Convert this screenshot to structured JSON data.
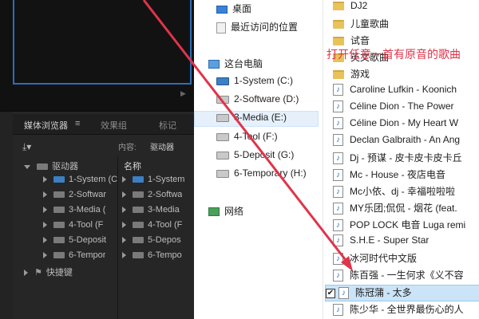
{
  "premiere": {
    "tabs": [
      {
        "label": "媒体浏览器"
      },
      {
        "label": "效果组"
      },
      {
        "label": "标记"
      }
    ],
    "tab_menu": "≡",
    "filter_label": "内容:",
    "filter_value": "驱动器",
    "tree_root": "驱动器",
    "drives": [
      "1-System (C",
      "2-Softwar",
      "3-Media (",
      "4-Tool (F",
      "5-Deposit",
      "6-Tempor"
    ],
    "shortcuts": "快捷键",
    "names_header": "名称",
    "name_items": [
      "1-System",
      "2-Softwa",
      "3-Media",
      "4-Tool (F",
      "5-Depos",
      "6-Tempo"
    ]
  },
  "nav": {
    "items": [
      {
        "label": "桌面",
        "icon": "desktop-icon"
      },
      {
        "label": "最近访问的位置",
        "icon": "recent-icon"
      },
      {
        "label": "这台电脑",
        "icon": "computer-icon"
      },
      {
        "label": "1-System (C:)",
        "icon": "system-drive-icon"
      },
      {
        "label": "2-Software (D:)",
        "icon": "drive-icon"
      },
      {
        "label": "3-Media (E:)",
        "icon": "drive-icon"
      },
      {
        "label": "4-Tool (F:)",
        "icon": "drive-icon"
      },
      {
        "label": "5-Deposit (G:)",
        "icon": "drive-icon"
      },
      {
        "label": "6-Temporary (H:)",
        "icon": "drive-icon"
      },
      {
        "label": "网络",
        "icon": "network-icon"
      }
    ]
  },
  "files": [
    {
      "label": "DJ2",
      "type": "folder"
    },
    {
      "label": "儿童歌曲",
      "type": "folder"
    },
    {
      "label": "试音",
      "type": "folder"
    },
    {
      "label": "英文歌曲",
      "type": "folder"
    },
    {
      "label": "游戏",
      "type": "folder"
    },
    {
      "label": "Caroline Lufkin - Koonich",
      "type": "audio"
    },
    {
      "label": "Céline  Dion - The  Power",
      "type": "audio"
    },
    {
      "label": "Céline Dion - My Heart W",
      "type": "audio"
    },
    {
      "label": "Declan Galbraith - An Ang",
      "type": "audio"
    },
    {
      "label": "Dj - 预谋 - 皮卡皮卡皮卡丘",
      "type": "audio"
    },
    {
      "label": "Mc - House - 夜店电音",
      "type": "audio"
    },
    {
      "label": "Mc小依、dj - 幸福啦啦啦",
      "type": "audio"
    },
    {
      "label": "MY乐团;侃侃 - 烟花 (feat.",
      "type": "audio"
    },
    {
      "label": "POP LOCK 电音 Luga remi",
      "type": "audio"
    },
    {
      "label": "S.H.E - Super Star",
      "type": "audio"
    },
    {
      "label": "冰河时代中文版",
      "type": "audio"
    },
    {
      "label": "陈百强 - 一生何求《义不容",
      "type": "audio"
    },
    {
      "label": "陈冠蒲 - 太多",
      "type": "audio",
      "selected": true
    },
    {
      "label": "陈少华 - 全世界最伤心的人",
      "type": "audio"
    }
  ],
  "annotation": "打开任意一首有原音的歌曲",
  "colors": {
    "annotation": "#e0344a",
    "premiere_accent": "#2d6db8",
    "selection": "#cce4f7"
  }
}
